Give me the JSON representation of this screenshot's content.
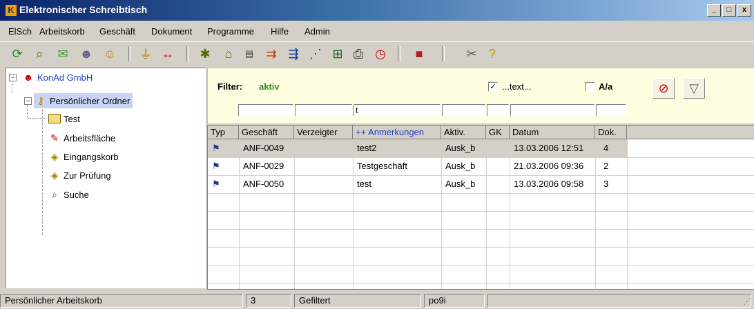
{
  "window": {
    "title": "Elektronischer Schreibtisch",
    "buttons": [
      "_",
      "□",
      "x"
    ]
  },
  "menu": [
    "ElSch",
    "Arbeitskorb",
    "Geschäft",
    "Dokument",
    "Programme",
    "Hilfe",
    "Admin"
  ],
  "toolbar": {
    "icons": [
      "refresh-icon",
      "search-icon",
      "mail-check-icon",
      "users-icon",
      "user-search-icon",
      "filter-icon",
      "column-width-icon",
      "new-case-icon",
      "home-case-icon",
      "document-icon",
      "merge-icon",
      "route-icon",
      "connect-icon",
      "tree-icon",
      "print-icon",
      "calendar-icon",
      "cubes-icon",
      "tools-icon",
      "help-icon"
    ]
  },
  "tree": {
    "root": "KonAd GmbH",
    "folder": "Persönlicher Ordner",
    "subfolder": "Test",
    "items": [
      "Arbeitsfläche",
      "Eingangskorb",
      "Zur Prüfung",
      "Suche"
    ]
  },
  "filter": {
    "label": "Filter:",
    "state": "aktiv",
    "text_option": {
      "checked": "✓",
      "label": "...text..."
    },
    "aa_option": {
      "checked": "",
      "label": "A/a"
    },
    "inputs": [
      "",
      "",
      "t",
      "",
      "",
      "",
      ""
    ]
  },
  "grid": {
    "columns": [
      "Typ",
      "Geschäft",
      "Verzeigter",
      "++ Anmerkungen",
      "Aktiv.",
      "GK",
      "Datum",
      "Dok."
    ],
    "rows": [
      {
        "geschaeft": "ANF-0049",
        "verzeigter": "",
        "anmerkungen": "test2",
        "aktiv": "Ausk_b",
        "gk": "",
        "datum": "13.03.2006 12:51",
        "dok": "4"
      },
      {
        "geschaeft": "ANF-0029",
        "verzeigter": "",
        "anmerkungen": "Testgeschäft",
        "aktiv": "Ausk_b",
        "gk": "",
        "datum": "21.03.2006 09:36",
        "dok": "2"
      },
      {
        "geschaeft": "ANF-0050",
        "verzeigter": "",
        "anmerkungen": "test",
        "aktiv": "Ausk_b",
        "gk": "",
        "datum": "13.03.2006 09:58",
        "dok": "3"
      }
    ]
  },
  "status": {
    "context": "Persönlicher Arbeitskorb",
    "count": "3",
    "filter": "Gefiltert",
    "user": "po9i",
    "extra": ""
  },
  "colors": {
    "accent_link": "#2040c0",
    "filter_active": "#228b22",
    "filter_bg": "#fffde0"
  }
}
